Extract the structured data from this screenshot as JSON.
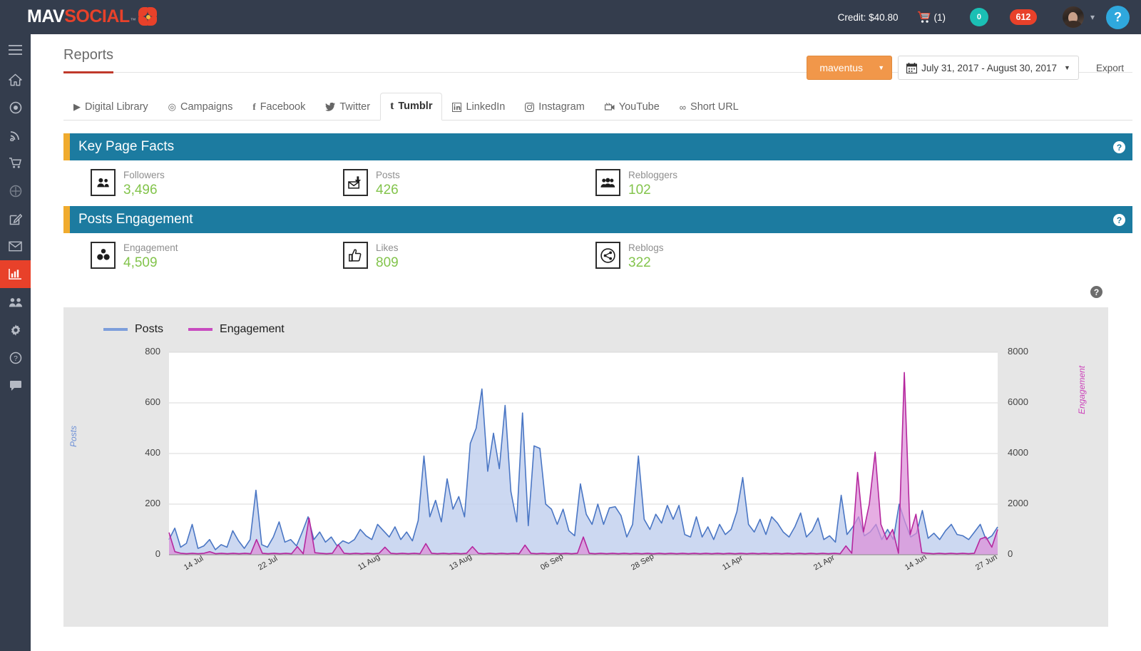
{
  "header": {
    "logo_mav": "MAV",
    "logo_social": "SOCIAL",
    "logo_tm": "™",
    "credit": "Credit: $40.80",
    "cart_count": "(1)",
    "messages_badge": "0",
    "notifications_badge": "612",
    "help_label": "?"
  },
  "sidebar": {
    "items": [
      {
        "name": "menu-toggle",
        "icon": "hamburger-icon"
      },
      {
        "name": "home",
        "icon": "home-icon"
      },
      {
        "name": "publish",
        "icon": "circle-dot-icon"
      },
      {
        "name": "feeds",
        "icon": "rss-icon"
      },
      {
        "name": "store",
        "icon": "cart-icon"
      },
      {
        "name": "listening",
        "icon": "target-icon"
      },
      {
        "name": "compose",
        "icon": "edit-icon"
      },
      {
        "name": "inbox",
        "icon": "mail-icon"
      },
      {
        "name": "reports",
        "icon": "bar-chart-icon"
      },
      {
        "name": "team",
        "icon": "users-icon"
      },
      {
        "name": "settings",
        "icon": "gear-icon"
      },
      {
        "name": "help",
        "icon": "question-icon"
      },
      {
        "name": "chat",
        "icon": "comment-icon"
      }
    ]
  },
  "page": {
    "title": "Reports",
    "account_selected": "maventus",
    "date_range": "July 31, 2017 - August 30, 2017",
    "export_label": "Export"
  },
  "tabs": [
    {
      "label": "Digital Library",
      "icon": "play-icon",
      "active": false
    },
    {
      "label": "Campaigns",
      "icon": "campaign-icon",
      "active": false
    },
    {
      "label": "Facebook",
      "icon": "facebook-icon",
      "active": false
    },
    {
      "label": "Twitter",
      "icon": "twitter-icon",
      "active": false
    },
    {
      "label": "Tumblr",
      "icon": "tumblr-icon",
      "active": true
    },
    {
      "label": "LinkedIn",
      "icon": "linkedin-icon",
      "active": false
    },
    {
      "label": "Instagram",
      "icon": "instagram-icon",
      "active": false
    },
    {
      "label": "YouTube",
      "icon": "youtube-icon",
      "active": false
    },
    {
      "label": "Short URL",
      "icon": "link-icon",
      "active": false
    }
  ],
  "sections": [
    {
      "title": "Key Page Facts",
      "help": "?",
      "stats": [
        {
          "label": "Followers",
          "value": "3,496",
          "icon": "followers-icon"
        },
        {
          "label": "Posts",
          "value": "426",
          "icon": "posts-icon"
        },
        {
          "label": "Rebloggers",
          "value": "102",
          "icon": "rebloggers-icon"
        }
      ]
    },
    {
      "title": "Posts Engagement",
      "help": "?",
      "stats": [
        {
          "label": "Engagement",
          "value": "4,509",
          "icon": "engagement-icon"
        },
        {
          "label": "Likes",
          "value": "809",
          "icon": "likes-icon"
        },
        {
          "label": "Reblogs",
          "value": "322",
          "icon": "reblogs-icon"
        }
      ]
    }
  ],
  "chart_help": "?",
  "colors": {
    "posts_line": "#4a76c4",
    "posts_fill": "#c3d1ee",
    "engagement_line": "#b5279e",
    "engagement_fill": "#dd8fd8",
    "panel_header": "#1c7ba0",
    "panel_accent": "#f0ab2e",
    "stat_value": "#83c44c",
    "brand_red": "#e8412a",
    "accent_orange": "#f1974a"
  },
  "chart_data": {
    "type": "area",
    "title": "",
    "xlabel": "",
    "ylabel": "Posts",
    "y2label": "Engagement",
    "ylim": [
      0,
      800
    ],
    "y2lim": [
      0,
      8000
    ],
    "yticks": [
      0,
      200,
      400,
      600,
      800
    ],
    "y2ticks": [
      0,
      2000,
      4000,
      6000,
      8000
    ],
    "grid": true,
    "legend_position": "top-left",
    "xticks": [
      "14 Jul",
      "22 Jul",
      "11 Aug",
      "13 Aug",
      "06 Sep",
      "28 Sep",
      "11 Apr",
      "21 Apr",
      "14 Jun",
      "27 Jun"
    ],
    "xtick_positions": [
      0.03,
      0.12,
      0.24,
      0.35,
      0.46,
      0.57,
      0.68,
      0.79,
      0.9,
      0.985
    ],
    "series": [
      {
        "name": "Posts",
        "axis": "left",
        "color": "#4a76c4",
        "fill": "#c3d1ee",
        "values": [
          60,
          105,
          30,
          45,
          120,
          25,
          35,
          60,
          20,
          40,
          30,
          95,
          55,
          25,
          60,
          255,
          40,
          30,
          70,
          130,
          50,
          60,
          35,
          90,
          150,
          60,
          90,
          50,
          70,
          35,
          55,
          45,
          60,
          100,
          75,
          60,
          120,
          95,
          70,
          110,
          60,
          90,
          55,
          135,
          390,
          150,
          215,
          130,
          300,
          180,
          230,
          150,
          440,
          500,
          655,
          330,
          480,
          340,
          590,
          250,
          130,
          560,
          115,
          430,
          420,
          200,
          180,
          120,
          180,
          95,
          75,
          280,
          160,
          120,
          200,
          120,
          185,
          190,
          155,
          70,
          120,
          390,
          140,
          100,
          160,
          125,
          195,
          140,
          195,
          80,
          70,
          150,
          70,
          110,
          60,
          120,
          80,
          100,
          170,
          305,
          120,
          90,
          140,
          80,
          150,
          125,
          90,
          70,
          110,
          165,
          70,
          95,
          145,
          60,
          75,
          50,
          235,
          80,
          110,
          150,
          75,
          90,
          120,
          60,
          100,
          60,
          200,
          130,
          70,
          85,
          175,
          65,
          85,
          60,
          95,
          120,
          80,
          75,
          60,
          90,
          120,
          60,
          75,
          110
        ]
      },
      {
        "name": "Engagement",
        "axis": "right",
        "color": "#b5279e",
        "fill": "#dd8fd8",
        "values": [
          880,
          120,
          60,
          40,
          60,
          40,
          60,
          120,
          40,
          60,
          40,
          60,
          40,
          60,
          40,
          600,
          60,
          40,
          60,
          40,
          60,
          40,
          320,
          40,
          1450,
          80,
          60,
          40,
          60,
          400,
          60,
          40,
          60,
          40,
          60,
          40,
          60,
          300,
          60,
          40,
          60,
          40,
          60,
          40,
          440,
          60,
          40,
          60,
          40,
          60,
          40,
          60,
          320,
          60,
          40,
          60,
          40,
          60,
          40,
          60,
          40,
          380,
          60,
          40,
          60,
          40,
          60,
          40,
          60,
          40,
          60,
          700,
          60,
          40,
          60,
          40,
          60,
          40,
          60,
          40,
          60,
          40,
          60,
          40,
          60,
          40,
          60,
          40,
          60,
          40,
          60,
          40,
          60,
          40,
          60,
          40,
          60,
          40,
          60,
          40,
          60,
          40,
          60,
          40,
          60,
          40,
          60,
          40,
          60,
          40,
          60,
          40,
          60,
          40,
          60,
          40,
          350,
          60,
          3250,
          900,
          2000,
          4050,
          1200,
          600,
          1000,
          60,
          7200,
          800,
          1600,
          80,
          60,
          40,
          60,
          40,
          60,
          40,
          60,
          40,
          60,
          620,
          700,
          300,
          1000
        ]
      }
    ]
  }
}
